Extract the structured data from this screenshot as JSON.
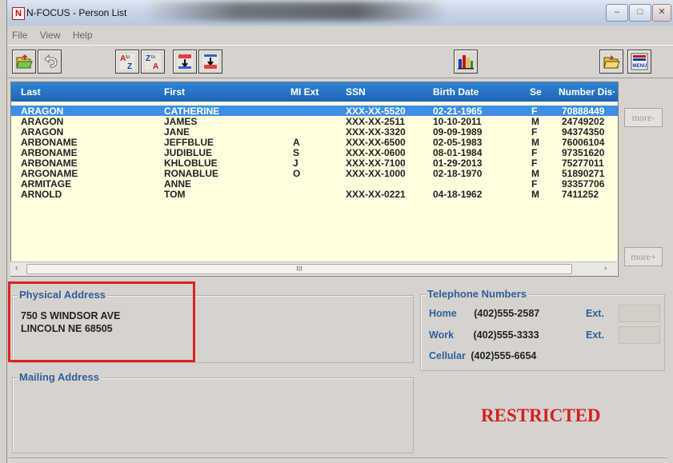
{
  "window": {
    "title": "N-FOCUS - Person List",
    "app_icon_letter": "N",
    "minimize_symbol": "–",
    "maximize_symbol": "□",
    "close_symbol": "✕"
  },
  "menu": [
    "File",
    "View",
    "Help"
  ],
  "toolbar": {
    "icons": [
      "open-folder-icon",
      "undo-icon",
      "sort-a-z-icon",
      "sort-z-a-icon",
      "sort-abc-down-icon",
      "sort-abc-up-icon",
      "bar-chart-icon",
      "folder-icon",
      "menu-icon"
    ],
    "sort_az": "A to Z",
    "sort_za": "Z to A",
    "menu_label": "MENU"
  },
  "columns": {
    "last": "Last",
    "first": "First",
    "mi_ext": "MI Ext",
    "ssn": "SSN",
    "birth_date": "Birth Date",
    "sex": "Se",
    "number": "Number Dis·"
  },
  "rows": [
    {
      "last": "ARAGON",
      "first": "CATHERINE",
      "mi": "",
      "ssn": "XXX-XX-5520",
      "birth": "02-21-1965",
      "sex": "F",
      "number": "70888449",
      "selected": true
    },
    {
      "last": "ARAGON",
      "first": "JAMES",
      "mi": "",
      "ssn": "XXX-XX-2511",
      "birth": "10-10-2011",
      "sex": "M",
      "number": "24749202",
      "selected": false
    },
    {
      "last": "ARAGON",
      "first": "JANE",
      "mi": "",
      "ssn": "XXX-XX-3320",
      "birth": "09-09-1989",
      "sex": "F",
      "number": "94374350",
      "selected": false
    },
    {
      "last": "ARBONAME",
      "first": "JEFFBLUE",
      "mi": "A",
      "ssn": "XXX-XX-6500",
      "birth": "02-05-1983",
      "sex": "M",
      "number": "76006104",
      "selected": false
    },
    {
      "last": "ARBONAME",
      "first": "JUDIBLUE",
      "mi": "S",
      "ssn": "XXX-XX-0600",
      "birth": "08-01-1984",
      "sex": "F",
      "number": "97351620",
      "selected": false
    },
    {
      "last": "ARBONAME",
      "first": "KHLOBLUE",
      "mi": "J",
      "ssn": "XXX-XX-7100",
      "birth": "01-29-2013",
      "sex": "F",
      "number": "75277011",
      "selected": false
    },
    {
      "last": "ARGONAME",
      "first": "RONABLUE",
      "mi": "O",
      "ssn": "XXX-XX-1000",
      "birth": "02-18-1970",
      "sex": "M",
      "number": "51890271",
      "selected": false
    },
    {
      "last": "ARMITAGE",
      "first": "ANNE",
      "mi": "",
      "ssn": "",
      "birth": "",
      "sex": "F",
      "number": "93357706",
      "selected": false
    },
    {
      "last": "ARNOLD",
      "first": "TOM",
      "mi": "",
      "ssn": "XXX-XX-0221",
      "birth": "04-18-1962",
      "sex": "M",
      "number": "7411252",
      "selected": false
    }
  ],
  "scroll": {
    "left_arrow": "‹",
    "right_arrow": "›",
    "thumb_grip": "III"
  },
  "buttons": {
    "more_up": "more-",
    "more_down": "more+"
  },
  "physical_address": {
    "title": "Physical Address",
    "line1": "750 S WINDSOR AVE",
    "line2": "LINCOLN NE  68505"
  },
  "mailing_address": {
    "title": "Mailing Address"
  },
  "telephone": {
    "title": "Telephone Numbers",
    "home_label": "Home",
    "home_value": "(402)555-2587",
    "work_label": "Work",
    "work_value": "(402)555-3333",
    "cell_label": "Cellular",
    "cell_value": "(402)555-6654",
    "ext_label": "Ext."
  },
  "status_banner": "RESTRICTED",
  "colors": {
    "list_background": "#ffffe0",
    "header_blue": "#1e63b2",
    "selection_blue": "#3d8ee6",
    "label_blue": "#2f5f9c",
    "restricted_red": "#d42020",
    "highlight_red": "#e02020"
  }
}
